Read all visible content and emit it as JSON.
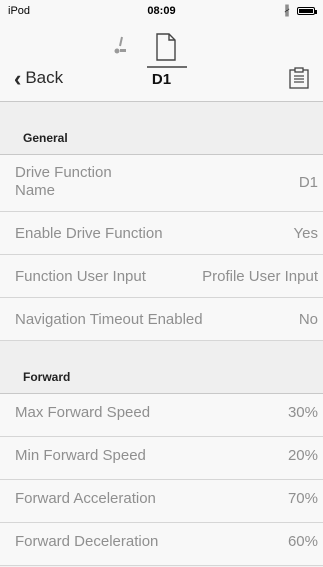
{
  "status_bar": {
    "carrier": "iPod",
    "time": "08:09"
  },
  "nav": {
    "back_label": "Back",
    "title": "D1",
    "icons": [
      "seat-icon",
      "document-icon",
      "clipboard-icon"
    ]
  },
  "sections": [
    {
      "title": "General",
      "rows": [
        {
          "label": "Drive Function\nName",
          "value": "D1"
        },
        {
          "label": "Enable Drive Function",
          "value": "Yes"
        },
        {
          "label": "Function User Input",
          "value": "Profile User Input"
        },
        {
          "label": "Navigation Timeout Enabled",
          "value": "No"
        }
      ]
    },
    {
      "title": "Forward",
      "rows": [
        {
          "label": "Max Forward Speed",
          "value": "30%"
        },
        {
          "label": "Min Forward Speed",
          "value": "20%"
        },
        {
          "label": "Forward Acceleration",
          "value": "70%"
        },
        {
          "label": "Forward Deceleration",
          "value": "60%"
        }
      ]
    }
  ]
}
